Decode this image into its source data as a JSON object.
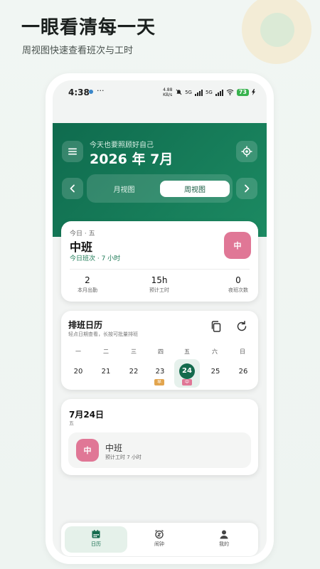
{
  "promo": {
    "headline": "一眼看清每一天",
    "subline": "周视图快速查看班次与工时"
  },
  "status_bar": {
    "time": "4:38",
    "more": "···",
    "net_speed": "4.88 KB/s",
    "sig1_label": "5G",
    "sig2_label": "5G",
    "battery": "73"
  },
  "header": {
    "greeting": "今天也要照顾好自己",
    "month_title": "2026 年 7月",
    "tabs": {
      "month": "月视图",
      "week": "周视图"
    },
    "active_tab": "week",
    "accent_color": "#146b4d"
  },
  "today": {
    "sub": "今日 · 五",
    "shift": "中班",
    "hours": "今日班次 · 7 小时",
    "badge": "中",
    "badge_color": "#e07796",
    "stats": [
      {
        "value": "2",
        "label": "本月出勤"
      },
      {
        "value": "15h",
        "label": "预计工时"
      },
      {
        "value": "0",
        "label": "夜班次数"
      }
    ]
  },
  "calendar": {
    "title": "排班日历",
    "hint": "轻点日期查看，长按可批量排班",
    "icons": [
      "copy-icon",
      "refresh-icon"
    ],
    "weekdays": [
      "一",
      "二",
      "三",
      "四",
      "五",
      "六",
      "日"
    ],
    "days": [
      "20",
      "21",
      "22",
      "23",
      "24",
      "25",
      "26"
    ],
    "selected": "24",
    "tags": {
      "early": "早",
      "mid": "中"
    },
    "tag_colors": {
      "early": "#e2a54e",
      "mid": "#e07796"
    }
  },
  "detail": {
    "date": "7月24日",
    "weekday": "五",
    "badge": "中",
    "shift": "中班",
    "hours": "预计工时 7 小时"
  },
  "tabbar": {
    "items": [
      {
        "label": "日历",
        "icon": "calendar-icon"
      },
      {
        "label": "闹钟",
        "icon": "alarm-icon"
      },
      {
        "label": "我的",
        "icon": "person-icon"
      }
    ],
    "active": "日历"
  }
}
